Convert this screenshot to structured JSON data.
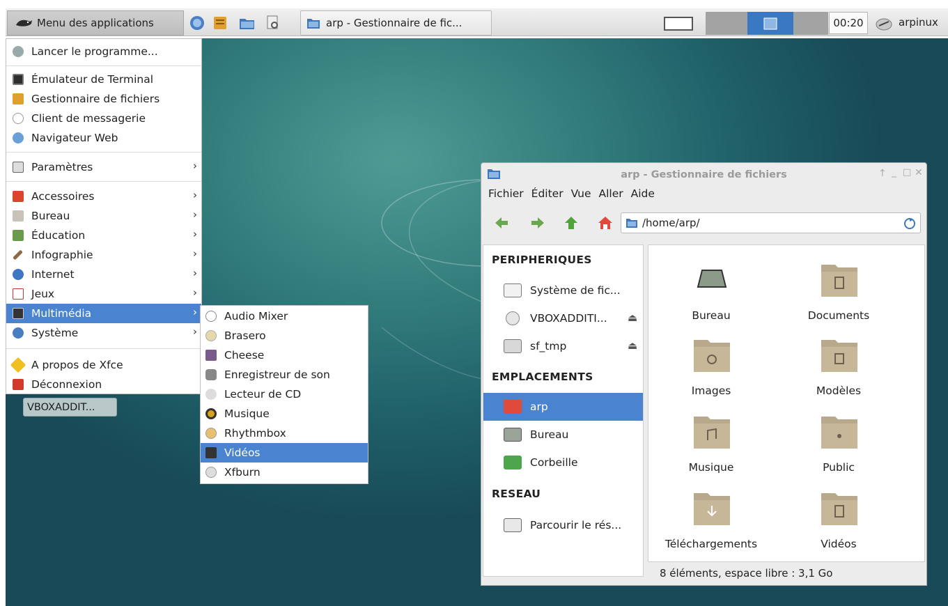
{
  "panel": {
    "app_menu_label": "Menu des applications",
    "task_title": "arp - Gestionnaire de fic...",
    "clock": "00:20",
    "username": "arpinux",
    "colors": {
      "workspace_active": "#3b78c4"
    }
  },
  "app_menu": {
    "items": [
      {
        "label": "Lancer le programme...",
        "icon": "run-icon"
      },
      {
        "label": "Émulateur de Terminal",
        "icon": "terminal-icon"
      },
      {
        "label": "Gestionnaire de fichiers",
        "icon": "file-manager-icon"
      },
      {
        "label": "Client de messagerie",
        "icon": "mail-icon"
      },
      {
        "label": "Navigateur Web",
        "icon": "web-browser-icon"
      },
      {
        "label": "Paramètres",
        "icon": "settings-icon"
      },
      {
        "label": "Accessoires",
        "icon": "accessories-icon"
      },
      {
        "label": "Bureau",
        "icon": "office-icon"
      },
      {
        "label": "Éducation",
        "icon": "education-icon"
      },
      {
        "label": "Infographie",
        "icon": "graphics-icon"
      },
      {
        "label": "Internet",
        "icon": "internet-icon"
      },
      {
        "label": "Jeux",
        "icon": "games-icon"
      },
      {
        "label": "Multimédia",
        "icon": "multimedia-icon"
      },
      {
        "label": "Système",
        "icon": "system-icon"
      },
      {
        "label": "A propos de Xfce",
        "icon": "about-icon"
      },
      {
        "label": "Déconnexion",
        "icon": "logout-icon"
      }
    ]
  },
  "submenu": {
    "items": [
      {
        "label": "Audio Mixer"
      },
      {
        "label": "Brasero"
      },
      {
        "label": "Cheese"
      },
      {
        "label": "Enregistreur de son"
      },
      {
        "label": "Lecteur de CD"
      },
      {
        "label": "Musique"
      },
      {
        "label": "Rhythmbox"
      },
      {
        "label": "Vidéos"
      },
      {
        "label": "Xfburn"
      }
    ]
  },
  "desktop": {
    "drive_label": "VBOXADDIT..."
  },
  "file_manager": {
    "title": "arp - Gestionnaire de fichiers",
    "menus": [
      "Fichier",
      "Éditer",
      "Vue",
      "Aller",
      "Aide"
    ],
    "path": "/home/arp/",
    "sidebar": {
      "devices_heading": "PERIPHERIQUES",
      "devices": [
        "Système de fic...",
        "VBOXADDITI...",
        "sf_tmp"
      ],
      "places_heading": "EMPLACEMENTS",
      "places": [
        "arp",
        "Bureau",
        "Corbeille"
      ],
      "network_heading": "RESEAU",
      "network": [
        "Parcourir le rés..."
      ]
    },
    "items": [
      "Bureau",
      "Documents",
      "Images",
      "Modèles",
      "Musique",
      "Public",
      "Téléchargements",
      "Vidéos"
    ],
    "status": "8 éléments, espace libre : 3,1 Go"
  }
}
